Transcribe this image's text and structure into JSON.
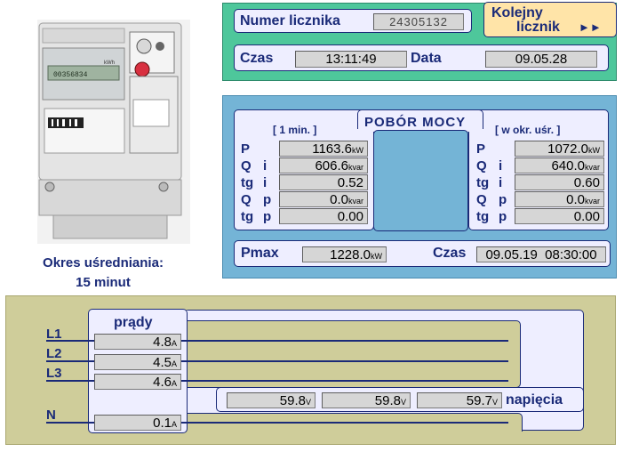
{
  "meter": {
    "number_label": "Numer licznika",
    "number_value": "24305132",
    "next_button_line1": "Kolejny",
    "next_button_line2": "licznik",
    "next_button_arrows": "►►",
    "time_label": "Czas",
    "time_value": "13:11:49",
    "date_label": "Data",
    "date_value": "09.05.28"
  },
  "averaging": {
    "line1": "Okres uśredniania:",
    "line2": "15 minut"
  },
  "power": {
    "title": "POBÓR MOCY",
    "left_header": "[ 1 min. ]",
    "right_header": "[ w okr. uśr. ]",
    "rows": [
      {
        "label_a": "P",
        "label_b": "",
        "left_value": "1163.6",
        "left_unit": "kW",
        "right_value": "1072.0",
        "right_unit": "kW"
      },
      {
        "label_a": "Q",
        "label_b": "i",
        "left_value": "606.6",
        "left_unit": "kvar",
        "right_value": "640.0",
        "right_unit": "kvar"
      },
      {
        "label_a": "tg",
        "label_b": "i",
        "left_value": "0.52",
        "left_unit": "",
        "right_value": "0.60",
        "right_unit": ""
      },
      {
        "label_a": "Q",
        "label_b": "p",
        "left_value": "0.0",
        "left_unit": "kvar",
        "right_value": "0.0",
        "right_unit": "kvar"
      },
      {
        "label_a": "tg",
        "label_b": "p",
        "left_value": "0.00",
        "left_unit": "",
        "right_value": "0.00",
        "right_unit": ""
      }
    ],
    "pmax_label": "Pmax",
    "pmax_value": "1228.0",
    "pmax_unit": "kW",
    "pmax_time_label": "Czas",
    "pmax_time_value": "09.05.19  08:30:00"
  },
  "currents": {
    "title": "prądy",
    "lines": [
      {
        "label": "L1",
        "value": "4.8",
        "unit": "A"
      },
      {
        "label": "L2",
        "value": "4.5",
        "unit": "A"
      },
      {
        "label": "L3",
        "value": "4.6",
        "unit": "A"
      },
      {
        "label": "N",
        "value": "0.1",
        "unit": "A"
      }
    ]
  },
  "voltages": {
    "title": "napięcia",
    "values": [
      {
        "value": "59.8",
        "unit": "V"
      },
      {
        "value": "59.8",
        "unit": "V"
      },
      {
        "value": "59.7",
        "unit": "V"
      }
    ]
  },
  "meter_photo": {
    "display_reading": "00356834",
    "display_unit": "kWh"
  }
}
